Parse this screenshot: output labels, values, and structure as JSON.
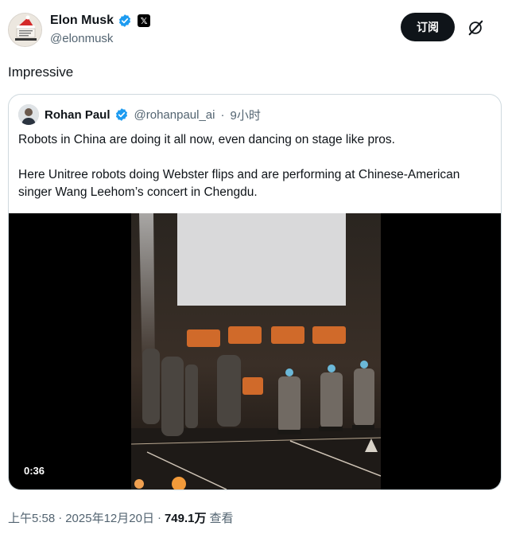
{
  "author": {
    "display_name": "Elon Musk",
    "handle": "@elonmusk",
    "affiliate_badge": "𝕏"
  },
  "actions": {
    "subscribe_label": "订阅"
  },
  "tweet": {
    "text": "Impressive"
  },
  "quoted": {
    "display_name": "Rohan Paul",
    "handle": "@rohanpaul_ai",
    "separator": "·",
    "time": "9小时",
    "paragraphs": [
      "Robots in China are doing it all now, even dancing on stage like pros.",
      "Here Unitree robots doing Webster flips and are performing at Chinese-American singer Wang Leehom’s concert in Chengdu."
    ],
    "video": {
      "duration": "0:36"
    }
  },
  "footer": {
    "time": "上午5:58",
    "sep1": "·",
    "date": "2025年12月20日",
    "sep2": "·",
    "views": "749.1万",
    "views_label": "查看"
  },
  "colors": {
    "verified": "#1d9bf0",
    "text_primary": "#0f1419",
    "text_secondary": "#536471",
    "border": "#cfd9de"
  }
}
